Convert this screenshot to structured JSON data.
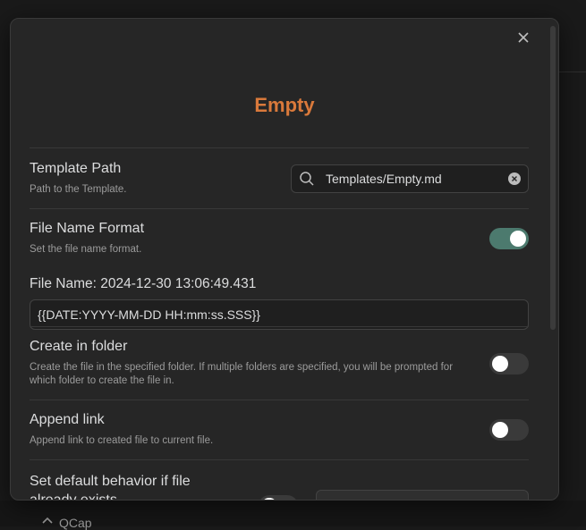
{
  "background": {
    "item_label": "QCap"
  },
  "modal": {
    "title": "Empty",
    "template_path": {
      "name": "Template Path",
      "description": "Path to the Template.",
      "value": "Templates/Empty.md"
    },
    "file_name_format": {
      "name": "File Name Format",
      "description": "Set the file name format.",
      "enabled": true,
      "preview": "File Name: 2024-12-30 13:06:49.431",
      "format_value": "{{DATE:YYYY-MM-DD HH:mm:ss.SSS}}"
    },
    "create_in_folder": {
      "name": "Create in folder",
      "description": "Create the file in the specified folder. If multiple folders are specified, you will be prompted for which folder to create the file in.",
      "enabled": false
    },
    "append_link": {
      "name": "Append link",
      "description": "Append link to created file to current file.",
      "enabled": false
    },
    "default_behavior": {
      "name": "Set default behavior if file already exists",
      "enabled": false
    }
  },
  "colors": {
    "accent": "#d9793b",
    "toggle_on": "#4c7a6e",
    "background": "#262626"
  }
}
